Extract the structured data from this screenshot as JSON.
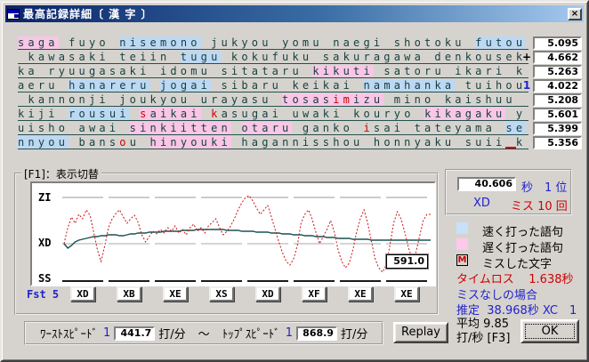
{
  "window": {
    "title": "最高記録詳細〔 漢 字 〕",
    "close_glyph": "×"
  },
  "rows": [
    {
      "mark": "",
      "mark_color": "#000000",
      "value": "5.095",
      "segments": [
        {
          "t": "saga",
          "c": "slow"
        },
        {
          "t": " fuyo "
        },
        {
          "t": "nisemono",
          "c": "fast"
        },
        {
          "t": " jukyou yomu naegi shotoku "
        },
        {
          "t": "futou",
          "c": "fast"
        }
      ]
    },
    {
      "mark": "+",
      "mark_color": "#000000",
      "value": "4.662",
      "segments": [
        {
          "t": " kawasaki teiin "
        },
        {
          "t": "tugu",
          "c": "fast"
        },
        {
          "t": " kokufuku sakuragawa denkousek"
        }
      ]
    },
    {
      "mark": "",
      "mark_color": "#000000",
      "value": "5.263",
      "segments": [
        {
          "t": "ka ryuugasaki idomu sitataru "
        },
        {
          "t": "kikuti",
          "c": "slow"
        },
        {
          "t": " satoru ikari k"
        }
      ]
    },
    {
      "mark": "1",
      "mark_color": "#2222cc",
      "value": "4.022",
      "segments": [
        {
          "t": "aeru "
        },
        {
          "t": "hanareru",
          "c": "fast"
        },
        {
          "t": " "
        },
        {
          "t": "jogai",
          "c": "fast"
        },
        {
          "t": " sibaru keikai "
        },
        {
          "t": "namahanka",
          "c": "fast"
        },
        {
          "t": " tuihou"
        }
      ]
    },
    {
      "mark": "",
      "mark_color": "#000000",
      "value": "5.208",
      "segments": [
        {
          "t": " kannonji joukyou urayasu "
        },
        {
          "t": "tosas",
          "c": "slow"
        },
        {
          "t": "im",
          "c": "slow miss"
        },
        {
          "t": "izu",
          "c": "slow"
        },
        {
          "t": " mino kaishuu"
        }
      ]
    },
    {
      "mark": "",
      "mark_color": "#000000",
      "value": "5.601",
      "segments": [
        {
          "t": "kiji "
        },
        {
          "t": "rousui",
          "c": "fast"
        },
        {
          "t": " "
        },
        {
          "t": "s",
          "c": "slow miss"
        },
        {
          "t": "aikai",
          "c": "slow"
        },
        {
          "t": " "
        },
        {
          "t": "k",
          "c": "miss"
        },
        {
          "t": "asugai uwaki kouryo "
        },
        {
          "t": "kikagaku",
          "c": "slow"
        },
        {
          "t": " y"
        }
      ]
    },
    {
      "mark": "",
      "mark_color": "#000000",
      "value": "5.399",
      "segments": [
        {
          "t": "uisho awai "
        },
        {
          "t": "sinkiitten",
          "c": "slow"
        },
        {
          "t": " "
        },
        {
          "t": "otaru",
          "c": "slow"
        },
        {
          "t": " ganko "
        },
        {
          "t": "i",
          "c": "miss"
        },
        {
          "t": "sai tateyama "
        },
        {
          "t": "se",
          "c": "fast"
        }
      ]
    },
    {
      "mark": "",
      "mark_color": "#000000",
      "value": "5.356",
      "segments": [
        {
          "t": "nnyou",
          "c": "fast"
        },
        {
          "t": " bans"
        },
        {
          "t": "o",
          "c": "miss"
        },
        {
          "t": "u "
        },
        {
          "t": "hinyouki",
          "c": "slow"
        },
        {
          "t": " hagannisshou honnyaku suii"
        },
        {
          "t": " ",
          "c": "missspace"
        },
        {
          "t": "k"
        }
      ]
    }
  ],
  "graph": {
    "group_label": "[F1]：表示切替",
    "y_labels": [
      "ZI",
      "XD",
      "SS"
    ],
    "cursor_value": "591.0",
    "fst_label": "Fst",
    "fst_count": "5",
    "line_buttons": [
      "XD",
      "XB",
      "XE",
      "XS",
      "XD",
      "XF",
      "XE",
      "XE"
    ],
    "red_series": [
      68,
      50,
      38,
      45,
      35,
      40,
      30,
      36,
      55,
      75,
      88,
      70,
      50,
      40,
      34,
      30,
      38,
      45,
      40,
      36,
      44,
      58,
      66,
      60,
      54,
      57,
      52,
      56,
      50,
      54,
      48,
      56,
      52,
      58,
      50,
      46,
      54,
      50,
      56,
      48,
      44,
      40,
      50,
      58,
      54,
      48,
      40,
      30,
      22,
      16,
      14,
      20,
      28,
      35,
      30,
      25,
      38,
      52,
      66,
      78,
      88,
      92,
      85,
      70,
      45,
      35,
      30,
      40,
      55,
      68,
      60,
      52,
      42,
      55,
      75,
      88,
      95,
      90,
      75,
      55,
      40,
      30,
      45,
      65,
      85,
      95,
      100,
      92,
      70,
      45,
      32,
      40,
      55,
      72,
      85,
      78,
      60,
      42,
      35,
      35
    ],
    "teal_series": [
      68,
      73,
      70,
      66,
      64,
      63,
      62,
      61,
      60,
      60,
      59,
      59,
      58,
      58,
      58,
      59,
      59,
      58,
      57,
      57,
      56,
      56,
      56,
      55,
      55,
      55,
      55,
      54,
      54,
      54,
      54,
      54,
      53,
      53,
      53,
      53,
      52,
      52,
      52,
      52,
      52,
      52,
      52,
      52,
      53,
      53,
      53,
      53,
      54,
      54,
      54,
      54,
      55,
      55,
      55,
      55,
      56,
      56,
      56,
      57,
      57,
      57,
      58,
      58,
      58,
      59,
      59,
      59,
      60,
      60,
      60,
      61,
      61,
      61,
      62,
      62,
      62,
      62,
      63,
      63,
      63,
      63,
      63,
      64,
      64,
      64,
      64,
      64,
      64,
      64,
      64,
      64,
      64,
      64,
      64,
      64,
      64,
      64,
      64,
      64
    ]
  },
  "stats": {
    "time_value": "40.606",
    "time_unit": "秒",
    "rank": "1 位",
    "mode": "XD",
    "miss": "ミス 10 回"
  },
  "legend": [
    {
      "type": "fast",
      "label": "速く打った語句"
    },
    {
      "type": "slow",
      "label": "遅く打った語句"
    },
    {
      "type": "miss",
      "badge": "M",
      "label": "ミスした文字"
    }
  ],
  "summary": {
    "timeloss_label": "タイムロス",
    "timeloss_value": "1.638秒",
    "nomiss_label": "ミスなしの場合",
    "estimate_label": "推定",
    "estimate_value": "38.968秒 XC　1",
    "average_line1": "平均  9.85",
    "average_line2": "打/秒 [F3]",
    "ok_label": "OK"
  },
  "speed": {
    "worst_label": "ﾜｰｽﾄｽﾋﾟｰﾄﾞ",
    "worst_rank": "1",
    "worst_value": "441.7",
    "worst_unit": "打/分",
    "tilde": "～",
    "top_label": "ﾄｯﾌﾟｽﾋﾟｰﾄﾞ",
    "top_rank": "1",
    "top_value": "868.9",
    "top_unit": "打/分",
    "replay_label": "Replay"
  }
}
